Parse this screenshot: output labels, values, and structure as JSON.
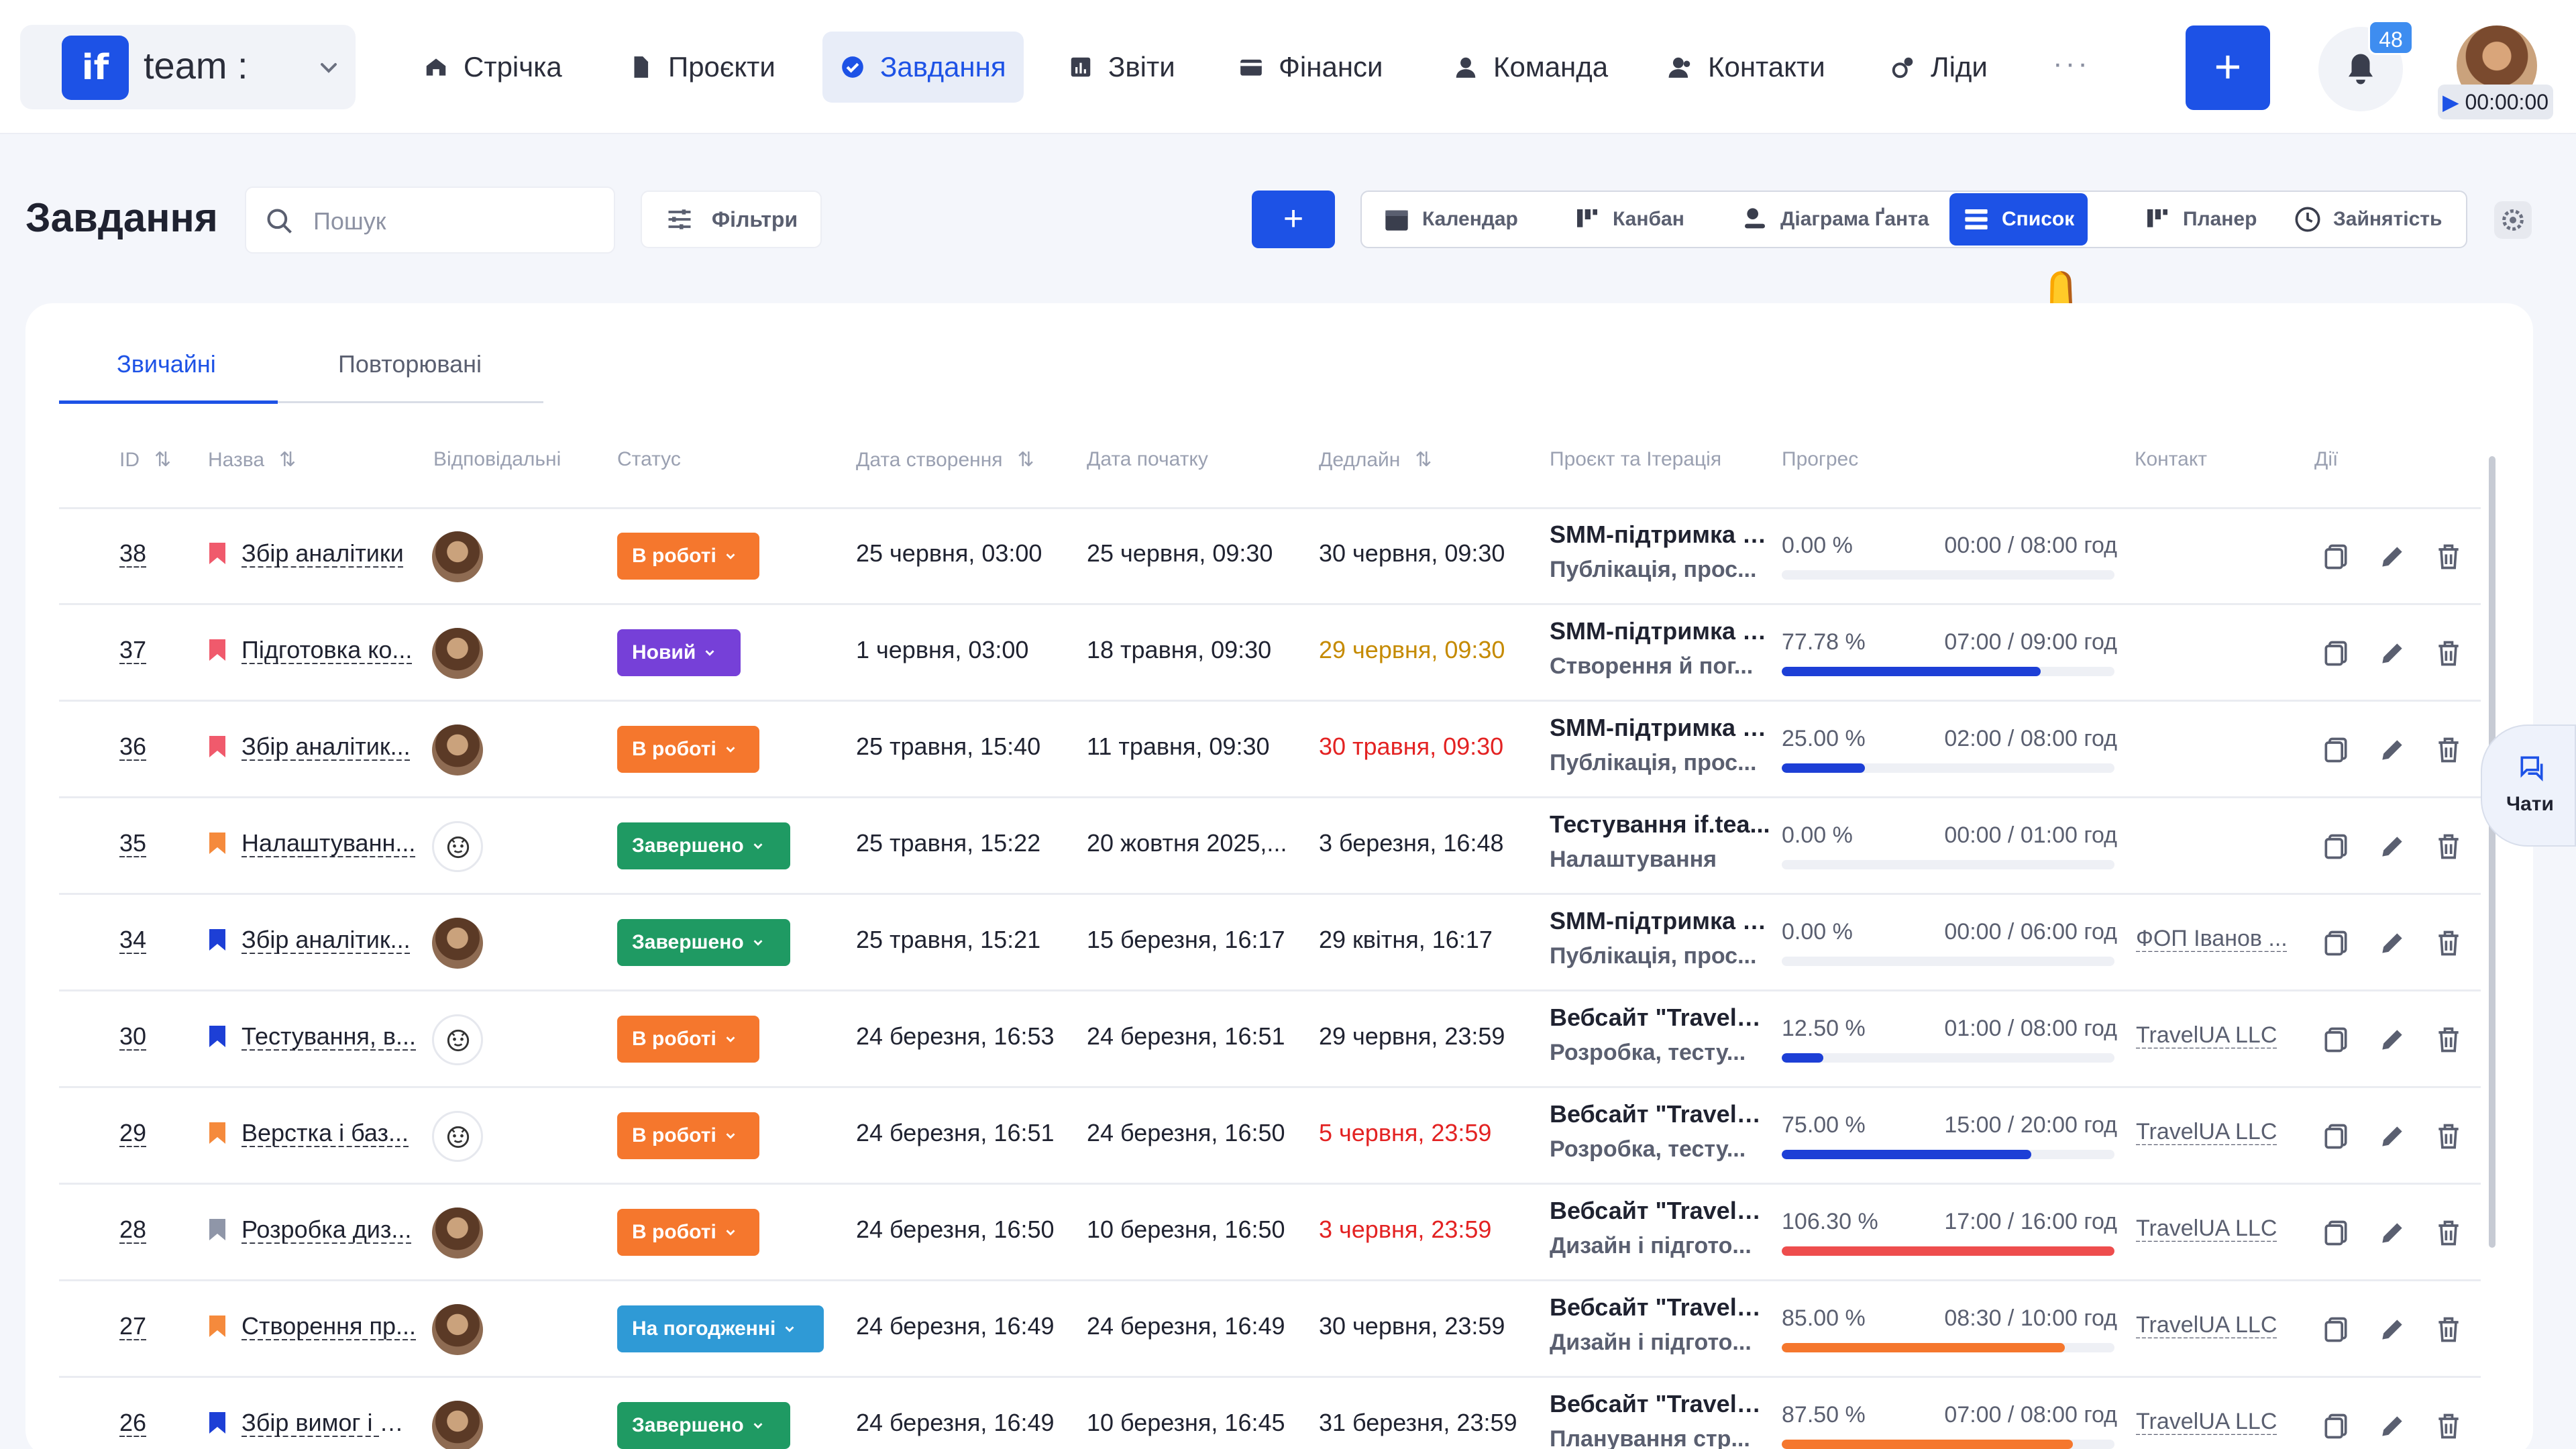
{
  "app": {
    "brand": "team :",
    "logo_text": "if",
    "nav": [
      {
        "label": "Стрічка",
        "icon": "home-icon"
      },
      {
        "label": "Проєкти",
        "icon": "document-icon"
      },
      {
        "label": "Завдання",
        "icon": "check-circle-icon",
        "active": true
      },
      {
        "label": "Звіти",
        "icon": "chart-icon"
      },
      {
        "label": "Фінанси",
        "icon": "wallet-icon"
      },
      {
        "label": "Команда",
        "icon": "user-icon"
      },
      {
        "label": "Контакти",
        "icon": "contacts-icon"
      },
      {
        "label": "Ліди",
        "icon": "leads-icon"
      }
    ],
    "more": "···",
    "add_label": "+",
    "notifications": "48",
    "timer": "00:00:00"
  },
  "page": {
    "title": "Завдання",
    "search_placeholder": "Пошук",
    "filters_label": "Фільтри",
    "add_label": "+",
    "views": [
      {
        "label": "Календар",
        "icon": "calendar-icon"
      },
      {
        "label": "Канбан",
        "icon": "kanban-icon"
      },
      {
        "label": "Діаграма Ґанта",
        "icon": "gantt-icon"
      },
      {
        "label": "Список",
        "icon": "list-icon",
        "active": true
      },
      {
        "label": "Планер",
        "icon": "planner-icon"
      },
      {
        "label": "Зайнятість",
        "icon": "clock-icon"
      }
    ],
    "pointer": "👆"
  },
  "tabs": [
    {
      "label": "Звичайні",
      "active": true
    },
    {
      "label": "Повторювані"
    }
  ],
  "columns": {
    "id": "ID",
    "name": "Назва",
    "assignees": "Відповідальні",
    "status": "Статус",
    "created": "Дата створення",
    "start": "Дата початку",
    "deadline": "Дедлайн",
    "project": "Проєкт та Ітерація",
    "progress": "Прогрес",
    "contact": "Контакт",
    "actions": "Дії"
  },
  "colors": {
    "accent": "#1d52e6",
    "status_in_work": "#f5772d",
    "status_new": "#7640d8",
    "status_done": "#1f9a63",
    "status_approval": "#2f9ad6",
    "deadline_warn": "#c58a00",
    "deadline_overdue": "#e32222",
    "bar_blue": "#1d3fd6",
    "bar_red": "#ee4d4d",
    "bar_orange": "#f5772d",
    "bookmark_red": "#f05a6c",
    "bookmark_orange": "#f58a3c",
    "bookmark_blue": "#1d3fd6",
    "bookmark_gray": "#8f96a8"
  },
  "rows": [
    {
      "id": "38",
      "title": "Збір аналітики",
      "bookmark": "red",
      "avatar": "photo",
      "status": "В роботі",
      "status_kind": "in_work",
      "created": "25 червня, 03:00",
      "start": "25 червня, 09:30",
      "deadline": "30 червня, 09:30",
      "deadline_state": "normal",
      "project": "SMM-підтримка \"...",
      "iteration": "Публікація, прос...",
      "percent": "0.00 %",
      "progress": 0.0,
      "hours": "00:00 / 08:00 год",
      "bar": "blue",
      "contact": ""
    },
    {
      "id": "37",
      "title": "Підготовка ко...",
      "bookmark": "red",
      "avatar": "photo",
      "status": "Новий",
      "status_kind": "new",
      "created": "1 червня, 03:00",
      "start": "18 травня, 09:30",
      "deadline": "29 червня, 09:30",
      "deadline_state": "warn",
      "project": "SMM-підтримка \"...",
      "iteration": "Створення й пог...",
      "percent": "77.78 %",
      "progress": 0.7778,
      "hours": "07:00 / 09:00 год",
      "bar": "blue",
      "contact": ""
    },
    {
      "id": "36",
      "title": "Збір аналітик...",
      "bookmark": "red",
      "avatar": "photo",
      "status": "В роботі",
      "status_kind": "in_work",
      "created": "25 травня, 15:40",
      "start": "11 травня, 09:30",
      "deadline": "30 травня, 09:30",
      "deadline_state": "overdue",
      "project": "SMM-підтримка \"...",
      "iteration": "Публікація, прос...",
      "percent": "25.00 %",
      "progress": 0.25,
      "hours": "02:00 / 08:00 год",
      "bar": "blue",
      "contact": ""
    },
    {
      "id": "35",
      "title": "Налаштуванн...",
      "bookmark": "orange",
      "avatar": "bot",
      "status": "Завершено",
      "status_kind": "done",
      "created": "25 травня, 15:22",
      "start": "20 жовтня 2025,...",
      "deadline": "3 березня, 16:48",
      "deadline_state": "normal",
      "project": "Тестування if.tea...",
      "iteration": "Налаштування",
      "percent": "0.00 %",
      "progress": 0.0,
      "hours": "00:00 / 01:00 год",
      "bar": "blue",
      "contact": ""
    },
    {
      "id": "34",
      "title": "Збір аналітик...",
      "bookmark": "blue",
      "avatar": "photo",
      "status": "Завершено",
      "status_kind": "done",
      "created": "25 травня, 15:21",
      "start": "15 березня, 16:17",
      "deadline": "29 квітня, 16:17",
      "deadline_state": "normal",
      "project": "SMM-підтримка \"...",
      "iteration": "Публікація, прос...",
      "percent": "0.00 %",
      "progress": 0.0,
      "hours": "00:00 / 06:00 год",
      "bar": "blue",
      "contact": "ФОП Іванов ..."
    },
    {
      "id": "30",
      "title": "Тестування, в...",
      "bookmark": "blue",
      "avatar": "bot",
      "status": "В роботі",
      "status_kind": "in_work",
      "created": "24 березня, 16:53",
      "start": "24 березня, 16:51",
      "deadline": "29 червня, 23:59",
      "deadline_state": "normal",
      "project": "Вебсайт \"TravelU...",
      "iteration": "Розробка, тесту...",
      "percent": "12.50 %",
      "progress": 0.125,
      "hours": "01:00 / 08:00 год",
      "bar": "blue",
      "contact": "TravelUA LLC"
    },
    {
      "id": "29",
      "title": "Верстка і баз...",
      "bookmark": "orange",
      "avatar": "bot",
      "status": "В роботі",
      "status_kind": "in_work",
      "created": "24 березня, 16:51",
      "start": "24 березня, 16:50",
      "deadline": "5 червня, 23:59",
      "deadline_state": "overdue",
      "project": "Вебсайт \"TravelU...",
      "iteration": "Розробка, тесту...",
      "percent": "75.00 %",
      "progress": 0.75,
      "hours": "15:00 / 20:00 год",
      "bar": "blue",
      "contact": "TravelUA LLC"
    },
    {
      "id": "28",
      "title": "Розробка диз...",
      "bookmark": "gray",
      "avatar": "photo",
      "status": "В роботі",
      "status_kind": "in_work",
      "created": "24 березня, 16:50",
      "start": "10 березня, 16:50",
      "deadline": "3 червня, 23:59",
      "deadline_state": "overdue",
      "project": "Вебсайт \"TravelU...",
      "iteration": "Дизайн і підгото...",
      "percent": "106.30 %",
      "progress": 1.0,
      "hours": "17:00 / 16:00 год",
      "bar": "red",
      "contact": "TravelUA LLC"
    },
    {
      "id": "27",
      "title": "Створення пр...",
      "bookmark": "orange",
      "avatar": "photo",
      "status": "На погодженні",
      "status_kind": "approval",
      "created": "24 березня, 16:49",
      "start": "24 березня, 16:49",
      "deadline": "30 червня, 23:59",
      "deadline_state": "normal",
      "project": "Вебсайт \"TravelU...",
      "iteration": "Дизайн і підгото...",
      "percent": "85.00 %",
      "progress": 0.85,
      "hours": "08:30 / 10:00 год",
      "bar": "orange",
      "contact": "TravelUA LLC"
    },
    {
      "id": "26",
      "title": "Збір вимог і ф...",
      "bookmark": "blue",
      "avatar": "photo",
      "status": "Завершено",
      "status_kind": "done",
      "created": "24 березня, 16:49",
      "start": "10 березня, 16:45",
      "deadline": "31 березня, 23:59",
      "deadline_state": "normal",
      "project": "Вебсайт \"TravelU...",
      "iteration": "Планування стр...",
      "percent": "87.50 %",
      "progress": 0.875,
      "hours": "07:00 / 08:00 год",
      "bar": "orange",
      "contact": "TravelUA LLC"
    }
  ],
  "chats_label": "Чати"
}
